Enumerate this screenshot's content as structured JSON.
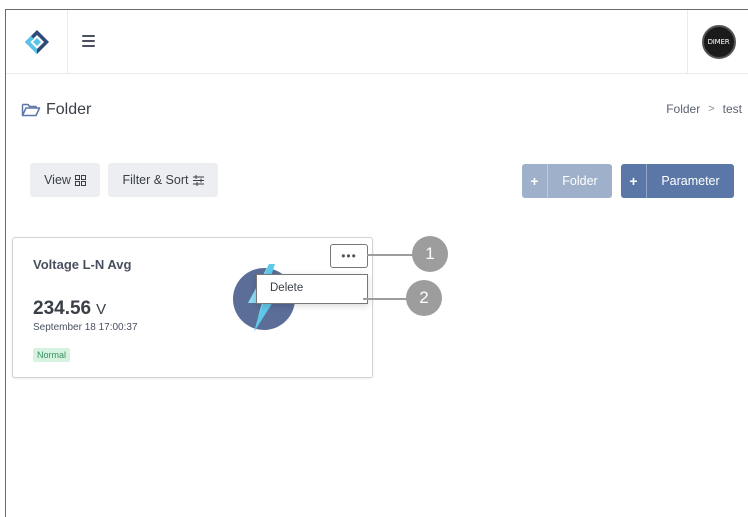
{
  "header": {
    "logo_icon": "app-logo-icon",
    "menu_icon": "hamburger-menu-icon",
    "avatar_text": "DIMER"
  },
  "page": {
    "title": "Folder",
    "title_icon": "folder-icon",
    "breadcrumb": [
      "Folder",
      "test"
    ],
    "breadcrumb_separator": ">"
  },
  "toolbar": {
    "view_label": "View",
    "view_icon": "grid-icon",
    "filter_label": "Filter & Sort",
    "filter_icon": "sliders-icon",
    "add_folder_plus": "+",
    "add_folder_label": "Folder",
    "add_parameter_plus": "+",
    "add_parameter_label": "Parameter"
  },
  "card": {
    "title": "Voltage L-N Avg",
    "value": "234.56",
    "unit": "V",
    "timestamp": "September 18 17:00:37",
    "status": "Normal",
    "icon": "lightning-bolt-icon",
    "more_label": "•••",
    "menu": {
      "items": [
        "Delete"
      ]
    }
  },
  "callouts": [
    "1",
    "2"
  ],
  "colors": {
    "primary": "#5a77a7",
    "primary_light": "#9fb0cb",
    "status_normal_bg": "#d6f3e1",
    "status_normal_text": "#3a8e5e",
    "callout": "#9d9d9d"
  }
}
